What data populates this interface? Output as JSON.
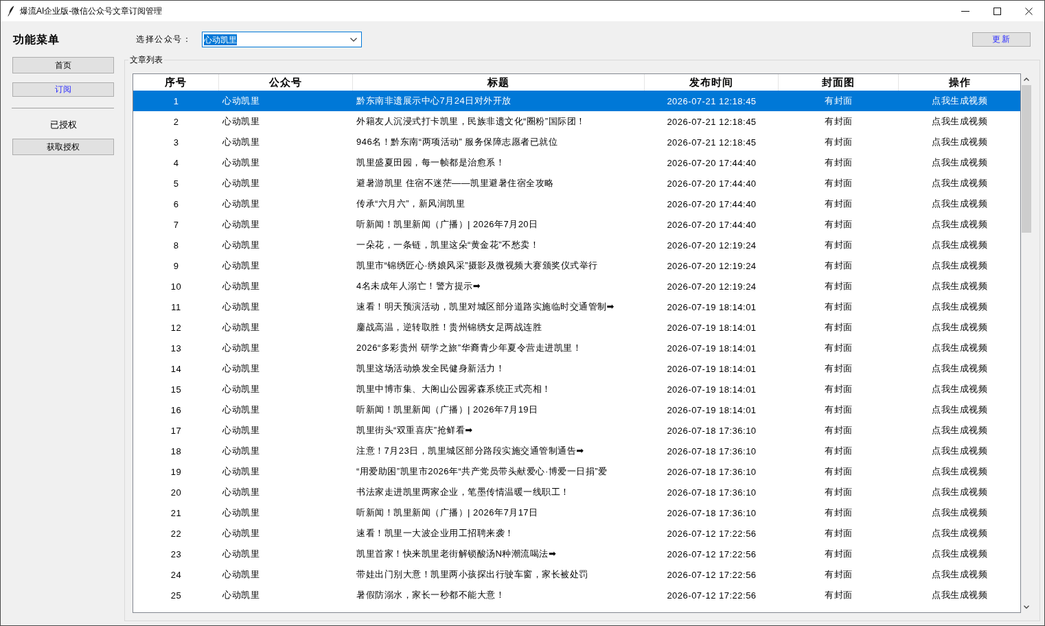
{
  "window": {
    "title": "爆流AI企业版-微信公众号文章订阅管理"
  },
  "sidebar": {
    "title": "功能菜单",
    "nav_buttons": [
      {
        "label": "首页",
        "selected": false
      },
      {
        "label": "订阅",
        "selected": true
      }
    ],
    "auth_status": "已授权",
    "auth_button": "获取授权"
  },
  "account_selector": {
    "label": "选择公众号：",
    "value": "心动凯里",
    "text_selected": true
  },
  "refresh_button": "更新",
  "article_list": {
    "title": "文章列表",
    "columns": [
      "序号",
      "公众号",
      "标题",
      "发布时间",
      "封面图",
      "操作"
    ],
    "rows": [
      {
        "index": "1",
        "account": "心动凯里",
        "title": "黔东南非遗展示中心7月24日对外开放",
        "published": "2026-07-21 12:18:45",
        "cover": "有封面",
        "action": "点我生成视频",
        "selected": true
      },
      {
        "index": "2",
        "account": "心动凯里",
        "title": "外籍友人沉浸式打卡凯里，民族非遗文化“圈粉”国际团！",
        "published": "2026-07-21 12:18:45",
        "cover": "有封面",
        "action": "点我生成视频",
        "selected": false
      },
      {
        "index": "3",
        "account": "心动凯里",
        "title": "946名！黔东南“两项活动” 服务保障志愿者已就位",
        "published": "2026-07-21 12:18:45",
        "cover": "有封面",
        "action": "点我生成视频",
        "selected": false
      },
      {
        "index": "4",
        "account": "心动凯里",
        "title": "凯里盛夏田园，每一帧都是治愈系！",
        "published": "2026-07-20 17:44:40",
        "cover": "有封面",
        "action": "点我生成视频",
        "selected": false
      },
      {
        "index": "5",
        "account": "心动凯里",
        "title": "避暑游凯里 住宿不迷茫——凯里避暑住宿全攻略",
        "published": "2026-07-20 17:44:40",
        "cover": "有封面",
        "action": "点我生成视频",
        "selected": false
      },
      {
        "index": "6",
        "account": "心动凯里",
        "title": "传承“六月六”，新风润凯里",
        "published": "2026-07-20 17:44:40",
        "cover": "有封面",
        "action": "点我生成视频",
        "selected": false
      },
      {
        "index": "7",
        "account": "心动凯里",
        "title": "听新闻！凯里新闻（广播）| 2026年7月20日",
        "published": "2026-07-20 17:44:40",
        "cover": "有封面",
        "action": "点我生成视频",
        "selected": false
      },
      {
        "index": "8",
        "account": "心动凯里",
        "title": "一朵花，一条链，凯里这朵“黄金花”不愁卖！",
        "published": "2026-07-20 12:19:24",
        "cover": "有封面",
        "action": "点我生成视频",
        "selected": false
      },
      {
        "index": "9",
        "account": "心动凯里",
        "title": "凯里市“锦绣匠心·绣娘风采”摄影及微视频大赛颁奖仪式举行",
        "published": "2026-07-20 12:19:24",
        "cover": "有封面",
        "action": "点我生成视频",
        "selected": false
      },
      {
        "index": "10",
        "account": "心动凯里",
        "title": "4名未成年人溺亡！警方提示➡",
        "published": "2026-07-20 12:19:24",
        "cover": "有封面",
        "action": "点我生成视频",
        "selected": false
      },
      {
        "index": "11",
        "account": "心动凯里",
        "title": "速看！明天预演活动，凯里对城区部分道路实施临时交通管制➡",
        "published": "2026-07-19 18:14:01",
        "cover": "有封面",
        "action": "点我生成视频",
        "selected": false
      },
      {
        "index": "12",
        "account": "心动凯里",
        "title": "鏖战高温，逆转取胜！贵州锦绣女足两战连胜",
        "published": "2026-07-19 18:14:01",
        "cover": "有封面",
        "action": "点我生成视频",
        "selected": false
      },
      {
        "index": "13",
        "account": "心动凯里",
        "title": "2026“多彩贵州 研学之旅”华裔青少年夏令营走进凯里！",
        "published": "2026-07-19 18:14:01",
        "cover": "有封面",
        "action": "点我生成视频",
        "selected": false
      },
      {
        "index": "14",
        "account": "心动凯里",
        "title": "凯里这场活动焕发全民健身新活力！",
        "published": "2026-07-19 18:14:01",
        "cover": "有封面",
        "action": "点我生成视频",
        "selected": false
      },
      {
        "index": "15",
        "account": "心动凯里",
        "title": "凯里中博市集、大阁山公园雾森系统正式亮相！",
        "published": "2026-07-19 18:14:01",
        "cover": "有封面",
        "action": "点我生成视频",
        "selected": false
      },
      {
        "index": "16",
        "account": "心动凯里",
        "title": "听新闻！凯里新闻（广播）| 2026年7月19日",
        "published": "2026-07-19 18:14:01",
        "cover": "有封面",
        "action": "点我生成视频",
        "selected": false
      },
      {
        "index": "17",
        "account": "心动凯里",
        "title": "凯里街头“双重喜庆”抢鲜看➡",
        "published": "2026-07-18 17:36:10",
        "cover": "有封面",
        "action": "点我生成视频",
        "selected": false
      },
      {
        "index": "18",
        "account": "心动凯里",
        "title": "注意！7月23日，凯里城区部分路段实施交通管制通告➡",
        "published": "2026-07-18 17:36:10",
        "cover": "有封面",
        "action": "点我生成视频",
        "selected": false
      },
      {
        "index": "19",
        "account": "心动凯里",
        "title": "“用爱助困”凯里市2026年“共产党员带头献爱心·博爱一日捐”爱",
        "published": "2026-07-18 17:36:10",
        "cover": "有封面",
        "action": "点我生成视频",
        "selected": false
      },
      {
        "index": "20",
        "account": "心动凯里",
        "title": "书法家走进凯里两家企业，笔墨传情温暖一线职工！",
        "published": "2026-07-18 17:36:10",
        "cover": "有封面",
        "action": "点我生成视频",
        "selected": false
      },
      {
        "index": "21",
        "account": "心动凯里",
        "title": "听新闻！凯里新闻（广播）| 2026年7月17日",
        "published": "2026-07-18 17:36:10",
        "cover": "有封面",
        "action": "点我生成视频",
        "selected": false
      },
      {
        "index": "22",
        "account": "心动凯里",
        "title": "速看！凯里一大波企业用工招聘来袭！",
        "published": "2026-07-12 17:22:56",
        "cover": "有封面",
        "action": "点我生成视频",
        "selected": false
      },
      {
        "index": "23",
        "account": "心动凯里",
        "title": "凯里首家！快来凯里老街解锁酸汤N种潮流喝法➡",
        "published": "2026-07-12 17:22:56",
        "cover": "有封面",
        "action": "点我生成视频",
        "selected": false
      },
      {
        "index": "24",
        "account": "心动凯里",
        "title": "带娃出门别大意！凯里两小孩探出行驶车窗，家长被处罚",
        "published": "2026-07-12 17:22:56",
        "cover": "有封面",
        "action": "点我生成视频",
        "selected": false
      },
      {
        "index": "25",
        "account": "心动凯里",
        "title": "暑假防溺水，家长一秒都不能大意！",
        "published": "2026-07-12 17:22:56",
        "cover": "有封面",
        "action": "点我生成视频",
        "selected": false
      }
    ]
  }
}
